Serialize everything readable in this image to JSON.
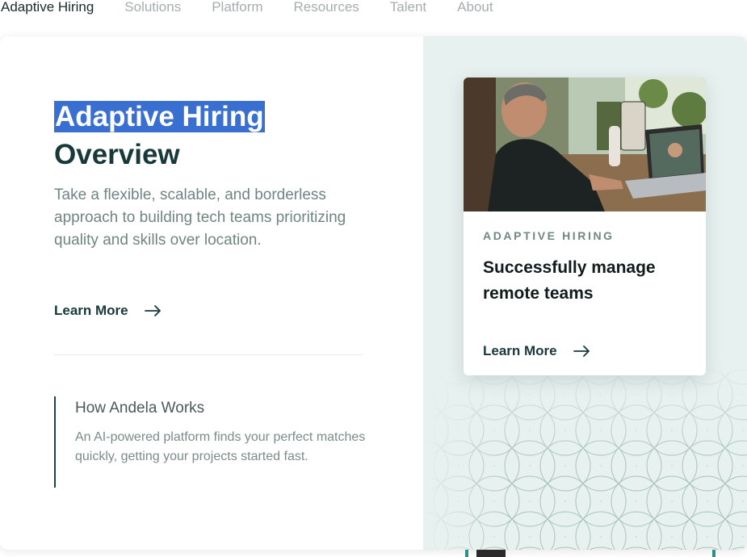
{
  "nav": {
    "items": [
      "Adaptive Hiring",
      "Solutions",
      "Platform",
      "Resources",
      "Talent",
      "About"
    ],
    "active": "Adaptive Hiring"
  },
  "hero": {
    "title_highlight": "Adaptive Hiring",
    "title_rest": "Overview",
    "description": "Take a flexible, scalable, and borderless approach to building tech teams prioritizing quality and skills over location.",
    "learn_more": "Learn More"
  },
  "how": {
    "title": "How Andela Works",
    "text": "An AI-powered platform finds your perfect matches quickly, getting your projects started fast."
  },
  "card": {
    "eyebrow": "ADAPTIVE HIRING",
    "title": "Successfully manage remote teams",
    "learn_more": "Learn More",
    "image_alt": "man on a video call with a woman using a laptop"
  },
  "colors": {
    "accent": "#17393a",
    "highlight": "#3a6fd2",
    "right_panel": "#e7f1ef"
  },
  "icons": {
    "arrow": "arrow-right-icon"
  }
}
